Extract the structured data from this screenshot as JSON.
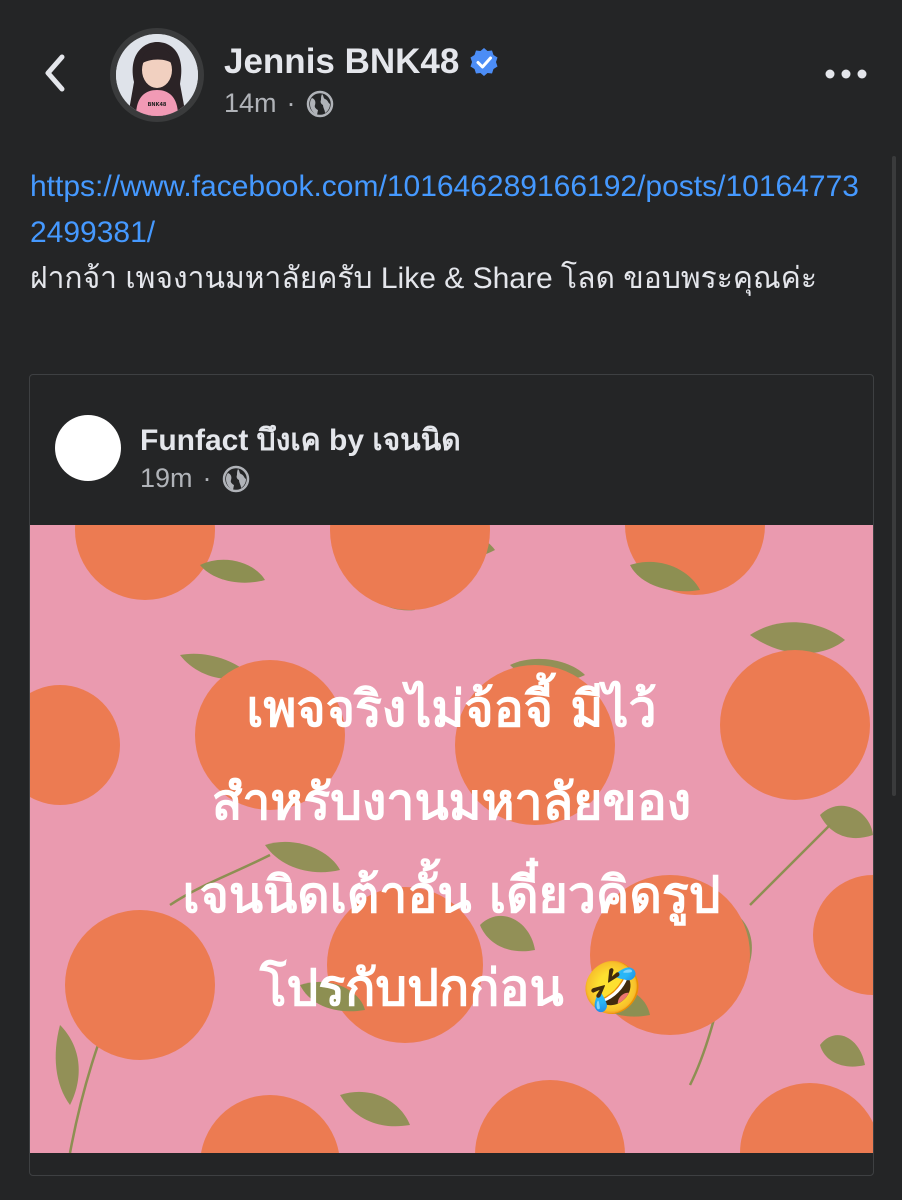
{
  "header": {
    "author_name": "Jennis BNK48",
    "timestamp": "14m",
    "separator": "·",
    "privacy_icon": "globe-icon",
    "back_icon": "chevron-left-icon",
    "more_icon": "more-dots-icon",
    "verified_icon": "verified-badge-icon",
    "avatar_shirt_text": "BNK48"
  },
  "post": {
    "link": "https://www.facebook.com/101646289166192/posts/101647732499381/",
    "text": "ฝากจ้า เพจงานมหาลัยครับ Like & Share โลด ขอบพระคุณค่ะ"
  },
  "shared": {
    "page_name": "Funfact บึงเค by เจนนิด",
    "timestamp": "19m",
    "separator": "·",
    "privacy_icon": "globe-icon",
    "status_lines": [
      "เพจจริงไม่จ้อจี้ มีไว้",
      "สำหรับงานมหาลัยของ",
      "เจนนิดเต้าอั้น เดี๋ยวคิดรูป",
      "โปรกับปกก่อน 🤣"
    ],
    "background": "peach-fruit-pattern"
  },
  "colors": {
    "background": "#242526",
    "text_primary": "#e4e6eb",
    "text_secondary": "#b0b3b8",
    "link": "#4599ff",
    "verified": "#1d9bf0",
    "status_bg": "#ea9aaf",
    "peach": "#ec7b52",
    "leaf": "#8d8f52"
  }
}
